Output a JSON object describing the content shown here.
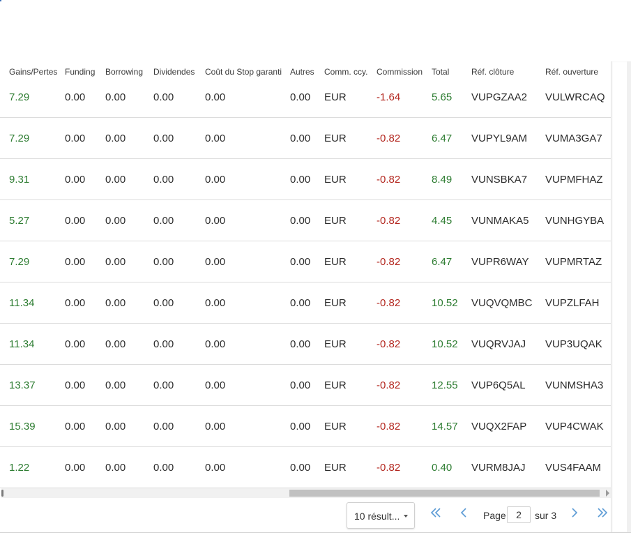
{
  "table": {
    "headers": [
      "Gains/Pertes",
      "Funding",
      "Borrowing",
      "Dividendes",
      "Coût du Stop garanti",
      "Autres",
      "Comm. ccy.",
      "Commission",
      "Total",
      "Réf. clôture",
      "Réf. ouverture"
    ],
    "rows": [
      [
        "7.29",
        "0.00",
        "0.00",
        "0.00",
        "0.00",
        "0.00",
        "EUR",
        "-1.64",
        "5.65",
        "VUPGZAA2",
        "VULWRCAQ"
      ],
      [
        "7.29",
        "0.00",
        "0.00",
        "0.00",
        "0.00",
        "0.00",
        "EUR",
        "-0.82",
        "6.47",
        "VUPYL9AM",
        "VUMA3GA7"
      ],
      [
        "9.31",
        "0.00",
        "0.00",
        "0.00",
        "0.00",
        "0.00",
        "EUR",
        "-0.82",
        "8.49",
        "VUNSBKA7",
        "VUPMFHAZ"
      ],
      [
        "5.27",
        "0.00",
        "0.00",
        "0.00",
        "0.00",
        "0.00",
        "EUR",
        "-0.82",
        "4.45",
        "VUNMAKA5",
        "VUNHGYBA"
      ],
      [
        "7.29",
        "0.00",
        "0.00",
        "0.00",
        "0.00",
        "0.00",
        "EUR",
        "-0.82",
        "6.47",
        "VUPR6WAY",
        "VUPMRTAZ"
      ],
      [
        "11.34",
        "0.00",
        "0.00",
        "0.00",
        "0.00",
        "0.00",
        "EUR",
        "-0.82",
        "10.52",
        "VUQVQMBC",
        "VUPZLFAH"
      ],
      [
        "11.34",
        "0.00",
        "0.00",
        "0.00",
        "0.00",
        "0.00",
        "EUR",
        "-0.82",
        "10.52",
        "VUQRVJAJ",
        "VUP3UQAK"
      ],
      [
        "13.37",
        "0.00",
        "0.00",
        "0.00",
        "0.00",
        "0.00",
        "EUR",
        "-0.82",
        "12.55",
        "VUP6Q5AL",
        "VUNMSHA3"
      ],
      [
        "15.39",
        "0.00",
        "0.00",
        "0.00",
        "0.00",
        "0.00",
        "EUR",
        "-0.82",
        "14.57",
        "VUQX2FAP",
        "VUP4CWAK"
      ],
      [
        "1.22",
        "0.00",
        "0.00",
        "0.00",
        "0.00",
        "0.00",
        "EUR",
        "-0.82",
        "0.40",
        "VURM8JAJ",
        "VUS4FAAM"
      ]
    ]
  },
  "pagination": {
    "per_page_label": "10 résult...",
    "page_label": "Page",
    "current_page": "2",
    "total_label": "sur 3"
  },
  "colors": {
    "positive": "#2e7d32",
    "negative": "#b3261e",
    "link": "#5b9bd5"
  },
  "icons": {
    "first": "double-chevron-left-icon",
    "prev": "chevron-left-icon",
    "next": "chevron-right-icon",
    "last": "double-chevron-right-icon",
    "dropdown": "caret-down-icon"
  }
}
